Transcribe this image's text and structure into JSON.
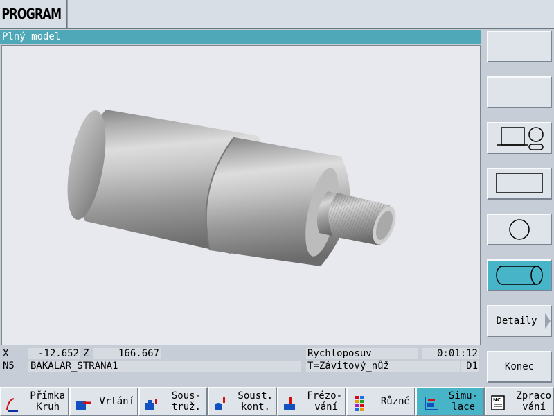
{
  "header": {
    "title": "PROGRAM"
  },
  "window": {
    "title": "Plný model"
  },
  "status": {
    "x_label": "X",
    "x_value": "-12.652",
    "z_label": "Z",
    "z_value": "166.667",
    "mode": "Rychloposuv",
    "time": "0:01:12",
    "block_no": "N5",
    "program_name": "BAKALAR_STRANA1",
    "tool": "T=Závitový_nůž",
    "offset": "D1"
  },
  "vertical_softkeys": [
    {
      "label": "",
      "icon": ""
    },
    {
      "label": "",
      "icon": ""
    },
    {
      "label": "",
      "icon": "three-view-icon"
    },
    {
      "label": "",
      "icon": "rectangle-view-icon"
    },
    {
      "label": "",
      "icon": "circle-view-icon"
    },
    {
      "label": "",
      "icon": "cylinder-view-icon",
      "active": true
    },
    {
      "label": "Detaily",
      "icon": "arrow-right-icon"
    },
    {
      "label": "",
      "icon": ""
    },
    {
      "label": "Konec",
      "icon": ""
    }
  ],
  "horizontal_softkeys": [
    {
      "line1": "Přímka",
      "line2": "Kruh",
      "icon": "line-circle-icon"
    },
    {
      "line1": "Vrtání",
      "line2": "",
      "icon": "drill-icon"
    },
    {
      "line1": "Sous-",
      "line2": "truž.",
      "icon": "turning-icon"
    },
    {
      "line1": "Soust.",
      "line2": "kont.",
      "icon": "contour-turning-icon"
    },
    {
      "line1": "Frézo-",
      "line2": "vání",
      "icon": "milling-icon"
    },
    {
      "line1": "Různé",
      "line2": "",
      "icon": "misc-icon"
    },
    {
      "line1": "Simu-",
      "line2": "lace",
      "icon": "simulation-icon",
      "active": true
    },
    {
      "line1": "Zpraco",
      "line2": "vání",
      "icon": "nc-icon"
    }
  ],
  "colors": {
    "accent": "#47b4c7",
    "title_bar": "#4fa8b8",
    "panel": "#c6cdd6",
    "viewport_bg": "#e7e9ee"
  }
}
